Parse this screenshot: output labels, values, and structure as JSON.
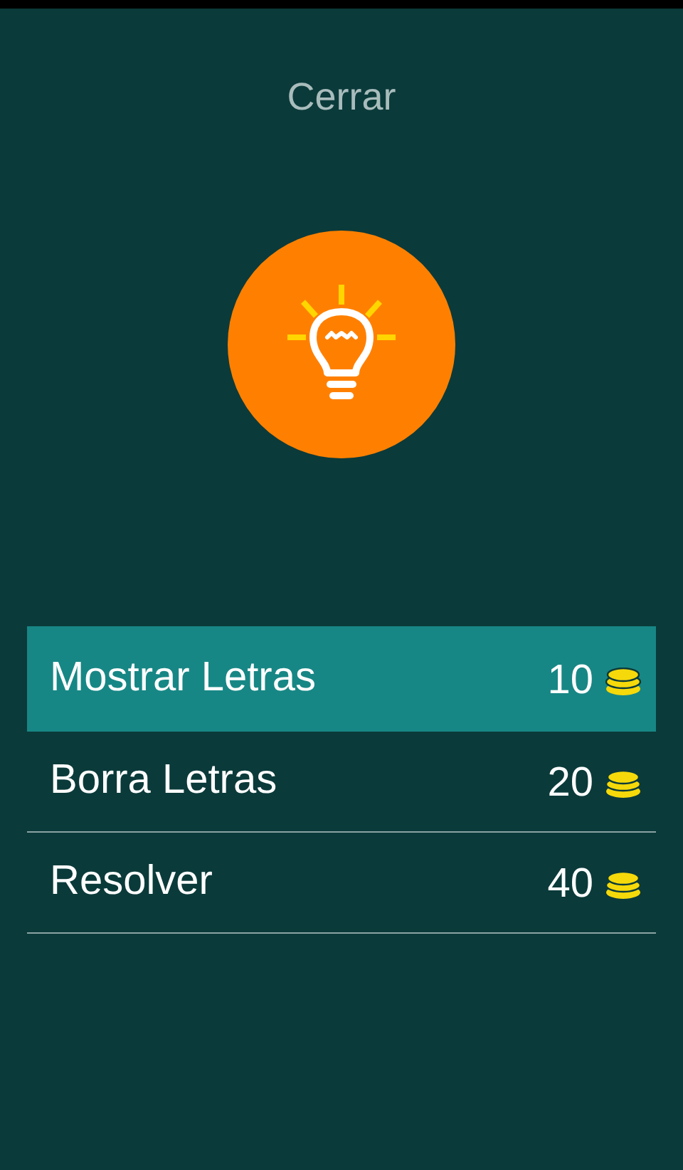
{
  "close_button": {
    "label": "Cerrar"
  },
  "hints": [
    {
      "label": "Mostrar Letras",
      "cost": "10",
      "selected": true
    },
    {
      "label": "Borra Letras",
      "cost": "20",
      "selected": false
    },
    {
      "label": "Resolver",
      "cost": "40",
      "selected": false
    }
  ]
}
